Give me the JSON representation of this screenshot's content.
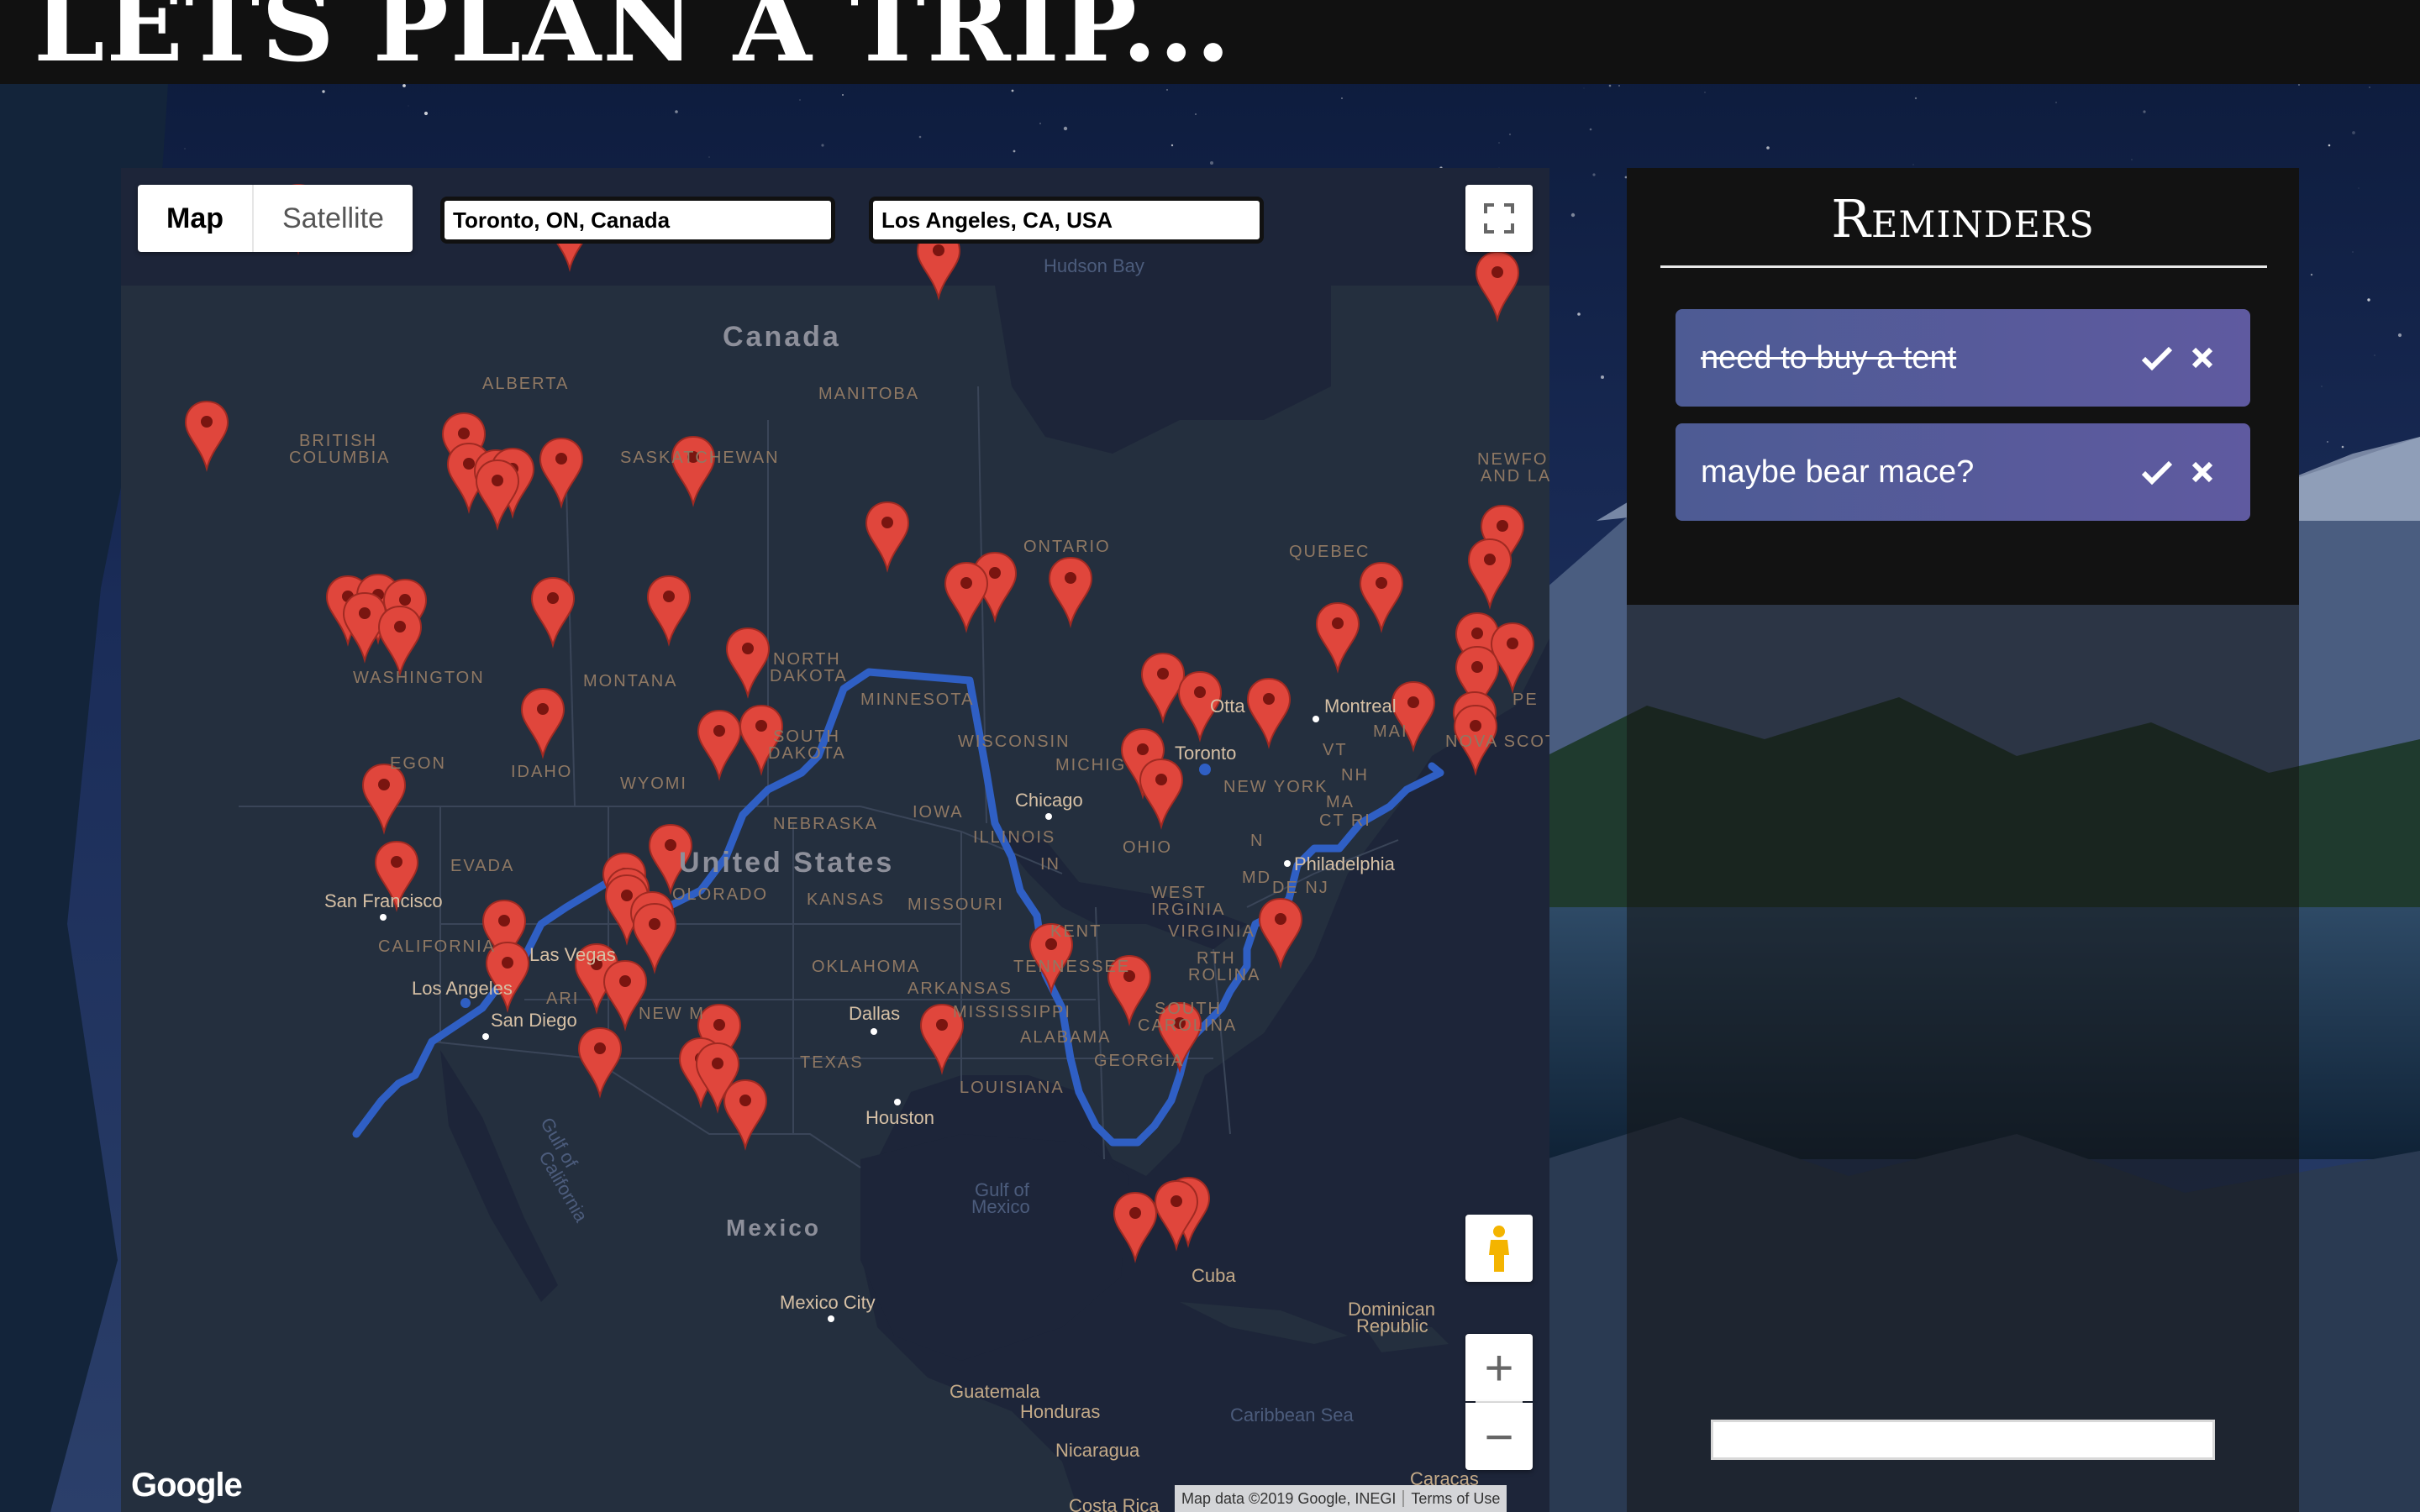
{
  "header": {
    "title": "LETS PLAN A TRIP..."
  },
  "map": {
    "type_control": {
      "map_label": "Map",
      "satellite_label": "Satellite",
      "selected": "Map"
    },
    "origin_input": {
      "value": "Toronto, ON, Canada"
    },
    "destination_input": {
      "value": "Los Angeles, CA, USA"
    },
    "labels": {
      "canada": "Canada",
      "united_states": "United States",
      "mexico": "Mexico",
      "hudson_bay": "Hudson Bay",
      "alberta": "ALBERTA",
      "manitoba": "MANITOBA",
      "british_columbia_1": "BRITISH",
      "british_columbia_2": "COLUMBIA",
      "saskatchewan": "SASKATCHEWAN",
      "ontario": "ONTARIO",
      "quebec": "QUEBEC",
      "newfoundland_1": "NEWFOU",
      "newfoundland_2": "AND LA",
      "washington": "WASHINGTON",
      "montana": "MONTANA",
      "north_dakota_1": "NORTH",
      "north_dakota_2": "DAKOTA",
      "minnesota": "MINNESOTA",
      "wisconsin": "WISCONSIN",
      "michigan": "MICHIG",
      "oregon": "EGON",
      "idaho": "IDAHO",
      "wyoming": "WYOMI",
      "south_dakota_1": "SOUTH",
      "south_dakota_2": "DAKOTA",
      "iowa": "IOWA",
      "nebraska": "NEBRASKA",
      "illinois": "ILLINOIS",
      "indiana": "IN",
      "ohio": "OHIO",
      "new_york": "NEW YORK",
      "nevada": "EVADA",
      "colorado": "OLORADO",
      "kansas": "KANSAS",
      "missouri": "MISSOURI",
      "west_virginia_1": "WEST",
      "west_virginia_2": "IRGINIA",
      "virginia": "VIRGINIA",
      "kentucky": "KENT",
      "california": "CALIFORNIA",
      "arizona": "ARI",
      "oklahoma": "OKLAHOMA",
      "arkansas": "ARKANSAS",
      "tennessee": "TENNESSEE",
      "north_carolina_1": "RTH",
      "north_carolina_2": "ROLINA",
      "new_mexico": "NEW M",
      "mississippi": "MISSISSIPPI",
      "alabama": "ALABAMA",
      "south_carolina_1": "SOUTH",
      "south_carolina_2": "CAROLINA",
      "georgia": "GEORGIA",
      "texas": "TEXAS",
      "louisiana": "LOUISIANA",
      "vermont": "VT",
      "new_hampshire": "NH",
      "massachusetts": "MA",
      "ct_ri": "CT RI",
      "maine": "MAI",
      "nova_scotia": "NOVA SCOT",
      "pei": "PE",
      "md": "MD",
      "de_nj": "DE NJ",
      "n_frag": "N",
      "gulf_of_california_1": "Gulf of",
      "gulf_of_california_2": "California",
      "gulf_of_mexico_1": "Gulf of",
      "gulf_of_mexico_2": "Mexico",
      "caribbean_sea": "Caribbean Sea",
      "cuba": "Cuba",
      "dominican_1": "Dominican",
      "dominican_2": "Republic",
      "guatemala": "Guatemala",
      "honduras": "Honduras",
      "nicaragua": "Nicaragua",
      "costa_rica": "Costa Rica",
      "caracas": "Caracas"
    },
    "cities": {
      "toronto": "Toronto",
      "ottawa": "Otta",
      "montreal": "Montreal",
      "chicago": "Chicago",
      "philadelphia": "Philadelphia",
      "san_francisco": "San Francisco",
      "las_vegas": "Las Vegas",
      "los_angeles": "Los Angeles",
      "san_diego": "San Diego",
      "dallas": "Dallas",
      "houston": "Houston",
      "mexico_city": "Mexico City"
    },
    "logo": "Google",
    "attribution": {
      "data": "Map data ©2019 Google, INEGI",
      "terms": "Terms of Use"
    },
    "icons": {
      "fullscreen": "fullscreen-icon",
      "pegman": "pegman-icon",
      "zoom_in": "+",
      "zoom_out": "−",
      "marker": "map-marker-icon"
    },
    "route_color": "#2f5fc4",
    "marker_color": "#e0463c"
  },
  "reminders": {
    "title": "Reminders",
    "items": [
      {
        "text": "need to buy a tent",
        "completed": true
      },
      {
        "text": "maybe bear mace?",
        "completed": false
      }
    ],
    "new_reminder_input": {
      "value": "",
      "placeholder": ""
    },
    "accent": "#5a5a9c"
  }
}
